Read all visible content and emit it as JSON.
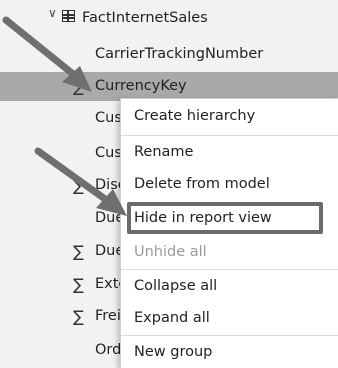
{
  "tree": {
    "table_name": "FactInternetSales",
    "rows": [
      {
        "label": "CarrierTrackingNumber",
        "sigma": false
      },
      {
        "label": "CurrencyKey",
        "sigma": true
      },
      {
        "label": "Cus",
        "sigma": false
      },
      {
        "label": "Cus",
        "sigma": false
      },
      {
        "label": "Disc",
        "sigma": true
      },
      {
        "label": "Due",
        "sigma": false
      },
      {
        "label": "Due",
        "sigma": true
      },
      {
        "label": "Exte",
        "sigma": true
      },
      {
        "label": "Frei",
        "sigma": true
      },
      {
        "label": "Ord",
        "sigma": false
      }
    ],
    "sigma_glyph": "∑"
  },
  "context_menu": {
    "items": [
      {
        "label": "Create hierarchy",
        "disabled": false
      },
      {
        "label": "Rename",
        "disabled": false
      },
      {
        "label": "Delete from model",
        "disabled": false
      },
      {
        "label": "Hide in report view",
        "disabled": false
      },
      {
        "label": "Unhide all",
        "disabled": true
      },
      {
        "label": "Collapse all",
        "disabled": false
      },
      {
        "label": "Expand all",
        "disabled": false
      },
      {
        "label": "New group",
        "disabled": false
      }
    ]
  },
  "colors": {
    "selected_row": "#a9a9a9",
    "highlight_border": "#6b6b6b",
    "arrow": "#6f6f6f"
  },
  "icons": [
    "chevron-down-icon",
    "table-icon",
    "sigma-icon",
    "arrow-pointer-icon"
  ]
}
